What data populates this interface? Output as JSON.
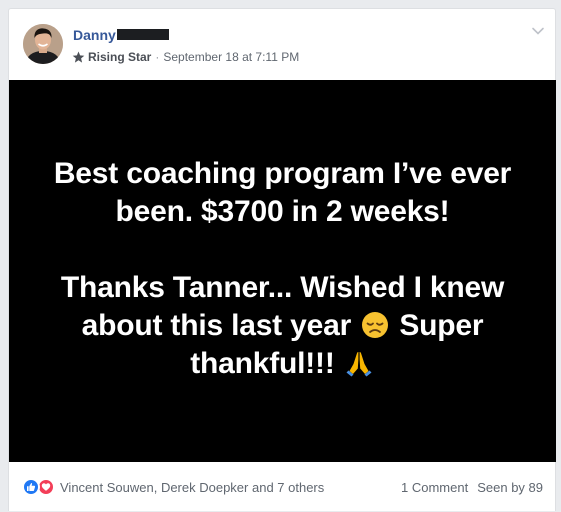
{
  "post": {
    "author_name": "Danny",
    "badge": {
      "icon": "rising-star-icon",
      "label": "Rising Star"
    },
    "separator": "·",
    "timestamp": "September 18 at 7:11 PM",
    "body": {
      "background_color": "#000000",
      "line_1": "Best coaching program I’ve ever been. $3700 in 2 weeks!",
      "line_2_text_a": "Thanks Tanner... Wished I knew about this last year",
      "line_2_emoji_1": "disappointed-face-emoji",
      "line_2_text_b": "Super thankful!!!",
      "line_2_emoji_2": "folded-hands-emoji"
    },
    "footer": {
      "reaction_icons": [
        "like-icon",
        "love-icon"
      ],
      "reactors": "Vincent Souwen, Derek Doepker and 7 others",
      "comments": "1 Comment",
      "seen_by": "Seen by 89"
    }
  },
  "colors": {
    "link_blue": "#365899",
    "meta_gray": "#606770",
    "like_blue": "#2078f4",
    "love_red": "#f33e58"
  }
}
